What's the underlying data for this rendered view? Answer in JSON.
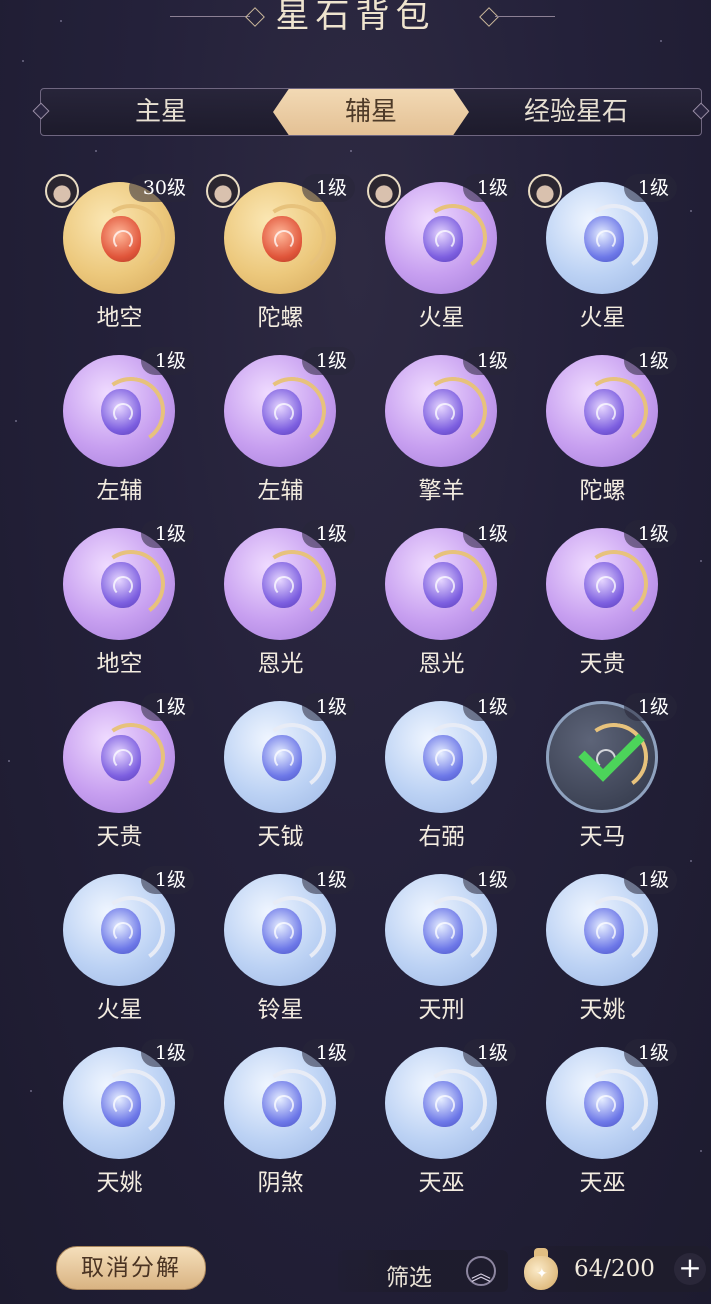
{
  "header": {
    "title": "星石背包"
  },
  "tabs": [
    {
      "label": "主星",
      "active": false
    },
    {
      "label": "辅星",
      "active": true
    },
    {
      "label": "经验星石",
      "active": false
    }
  ],
  "items": [
    {
      "name": "地空",
      "level": "30级",
      "rarity": "gold",
      "equipped": true,
      "selected": false
    },
    {
      "name": "陀螺",
      "level": "1级",
      "rarity": "gold",
      "equipped": true,
      "selected": false
    },
    {
      "name": "火星",
      "level": "1级",
      "rarity": "purple",
      "equipped": true,
      "selected": false
    },
    {
      "name": "火星",
      "level": "1级",
      "rarity": "blue",
      "equipped": true,
      "selected": false
    },
    {
      "name": "左辅",
      "level": "1级",
      "rarity": "purple",
      "equipped": false,
      "selected": false
    },
    {
      "name": "左辅",
      "level": "1级",
      "rarity": "purple",
      "equipped": false,
      "selected": false
    },
    {
      "name": "擎羊",
      "level": "1级",
      "rarity": "purple",
      "equipped": false,
      "selected": false
    },
    {
      "name": "陀螺",
      "level": "1级",
      "rarity": "purple",
      "equipped": false,
      "selected": false
    },
    {
      "name": "地空",
      "level": "1级",
      "rarity": "purple",
      "equipped": false,
      "selected": false
    },
    {
      "name": "恩光",
      "level": "1级",
      "rarity": "purple",
      "equipped": false,
      "selected": false
    },
    {
      "name": "恩光",
      "level": "1级",
      "rarity": "purple",
      "equipped": false,
      "selected": false
    },
    {
      "name": "天贵",
      "level": "1级",
      "rarity": "purple",
      "equipped": false,
      "selected": false
    },
    {
      "name": "天贵",
      "level": "1级",
      "rarity": "purple",
      "equipped": false,
      "selected": false
    },
    {
      "name": "天钺",
      "level": "1级",
      "rarity": "blue",
      "equipped": false,
      "selected": false
    },
    {
      "name": "右弼",
      "level": "1级",
      "rarity": "blue",
      "equipped": false,
      "selected": false
    },
    {
      "name": "天马",
      "level": "1级",
      "rarity": "blue",
      "equipped": false,
      "selected": true
    },
    {
      "name": "火星",
      "level": "1级",
      "rarity": "blue",
      "equipped": false,
      "selected": false
    },
    {
      "name": "铃星",
      "level": "1级",
      "rarity": "blue",
      "equipped": false,
      "selected": false
    },
    {
      "name": "天刑",
      "level": "1级",
      "rarity": "blue",
      "equipped": false,
      "selected": false
    },
    {
      "name": "天姚",
      "level": "1级",
      "rarity": "blue",
      "equipped": false,
      "selected": false
    },
    {
      "name": "天姚",
      "level": "1级",
      "rarity": "blue",
      "equipped": false,
      "selected": false
    },
    {
      "name": "阴煞",
      "level": "1级",
      "rarity": "blue",
      "equipped": false,
      "selected": false
    },
    {
      "name": "天巫",
      "level": "1级",
      "rarity": "blue",
      "equipped": false,
      "selected": false
    },
    {
      "name": "天巫",
      "level": "1级",
      "rarity": "blue",
      "equipped": false,
      "selected": false
    }
  ],
  "footer": {
    "cancel_label": "取消分解",
    "filter_label": "筛选",
    "filter_icon": "chevron-up-icon",
    "capacity": "64/200",
    "add_icon": "plus-icon"
  },
  "colors": {
    "background": "#24213a",
    "tab_active": "#e4c195",
    "gold": "#ecc87c",
    "purple": "#c79ff0",
    "blue": "#bcd2f4",
    "check": "#4cd45a"
  }
}
